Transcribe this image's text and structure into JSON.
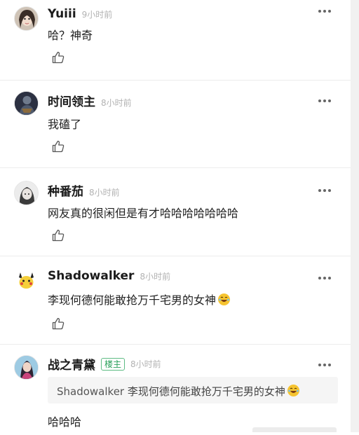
{
  "comments": [
    {
      "username": "Yuiii",
      "time": "9小时前",
      "text": "哈？神奇",
      "avatar": "avatar-girl"
    },
    {
      "username": "时间领主",
      "time": "8小时前",
      "text": "我磕了",
      "avatar": "avatar-figure-dark"
    },
    {
      "username": "种番茄",
      "time": "8小时前",
      "text": "网友真的很闲但是有才哈哈哈哈哈哈哈",
      "avatar": "avatar-girl-bw"
    },
    {
      "username": "Shadowalker",
      "time": "8小时前",
      "text": "李现何德何能敢抢万千宅男的女神",
      "emoji": "rofl-emoji",
      "avatar": "avatar-pikachu"
    },
    {
      "username": "战之青黛",
      "badge": "楼主",
      "time": "8小时前",
      "quote_name": "Shadowalker",
      "quote_text": "李现何德何能敢抢万千宅男的女神",
      "quote_emoji": "rofl-emoji",
      "text": "哈哈哈",
      "avatar": "avatar-woman-blue"
    }
  ],
  "icons": {
    "more": "more-dots-icon",
    "like": "thumbs-up-icon"
  },
  "colors": {
    "badge": "#2aa05b",
    "time": "#b2b2b2",
    "quote_bg": "#f5f5f5"
  }
}
